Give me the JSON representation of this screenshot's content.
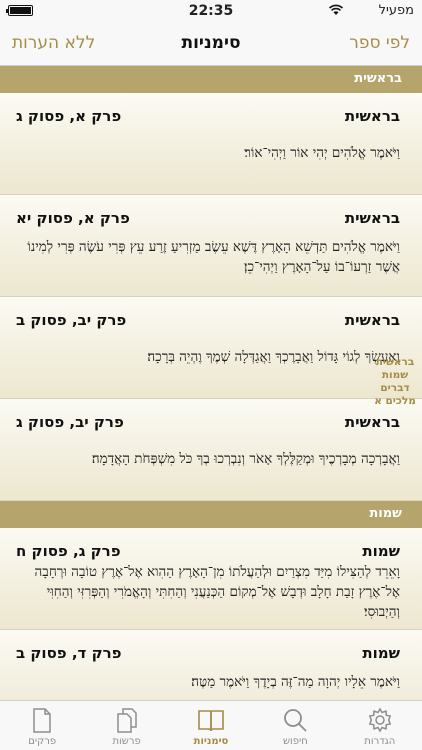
{
  "status_bar": {
    "carrier": "מפעיל",
    "time": "22:35"
  },
  "nav": {
    "title": "סימניות",
    "right_button": "לפי ספר",
    "left_button": "ללא הערות"
  },
  "colors": {
    "accent": "#a58d48",
    "section_bg": "#b5a56c"
  },
  "sections": [
    {
      "title": "בראשית",
      "rows": [
        {
          "book": "בראשית",
          "ref": "פרק א, פסוק ג",
          "verse": "וַיֹּאמֶר אֱלֹהִים יְהִי אוֹר וַיְהִי־אוֹר׃"
        },
        {
          "book": "בראשית",
          "ref": "פרק א, פסוק יא",
          "verse": "וַיֹּאמֶר אֱלֹהִים תַּדְשֵׁא הָאָרֶץ דֶּשֶׁא עֵשֶׂב מַזְרִיעַ זֶרַע עֵץ פְּרִי עֹשֶׂה פְּרִי לְמִינוֹ אֲשֶׁר זַרְעוֹ־בוֹ עַל־הָאָרֶץ וַיְהִי־כֵן׃"
        },
        {
          "book": "בראשית",
          "ref": "פרק יב, פסוק ב",
          "verse": "וְאֶעֶשְׂךָ לְגוֹי גָּדוֹל וַאֲבָרֶכְךָ וַאֲגַדְּלָה שְׁמֶךָ וֶהְיֵה בְּרָכָה׃"
        },
        {
          "book": "בראשית",
          "ref": "פרק יב, פסוק ג",
          "verse": "וַאֲבָרְכָה מְבָרְכֶיךָ וּמְקַלֶּלְךָ אָאֹר וְנִבְרְכוּ בְךָ כֹּל מִשְׁפְּחֹת הָאֲדָמָה׃"
        }
      ]
    },
    {
      "title": "שמות",
      "rows": [
        {
          "book": "שמות",
          "ref": "פרק ג, פסוק ח",
          "verse": "וָאֵרֵד לְהַצִּילוֹ מִיַּד מִצְרַיִם וּלְהַעֲלֹתוֹ מִן־הָאָרֶץ הַהִוא אֶל־אֶרֶץ טוֹבָה וּרְחָבָה אֶל־אֶרֶץ זָבַת חָלָב וּדְבָשׁ אֶל־מְקוֹם הַכְּנַעֲנִי וְהַחִתִּי וְהָאֱמֹרִי וְהַפְּרִזִּי וְהַחִוִּי וְהַיְבוּסִי׃"
        },
        {
          "book": "שמות",
          "ref": "פרק ד, פסוק ב",
          "verse": "וַיֹּאמֶר אֵלָיו יְהוָה מַה־זֶּה בְיָדֶךָ וַיֹּאמֶר מַטֶּה׃"
        }
      ]
    }
  ],
  "index": [
    "בראשית",
    "שמות",
    "דברים",
    "מלכים א"
  ],
  "tabs": [
    {
      "label": "הגדרות",
      "icon": "gear-icon"
    },
    {
      "label": "חיפוש",
      "icon": "search-icon"
    },
    {
      "label": "סימניות",
      "icon": "book-icon",
      "active": true
    },
    {
      "label": "פרשות",
      "icon": "documents-icon"
    },
    {
      "label": "פרקים",
      "icon": "document-icon"
    }
  ]
}
